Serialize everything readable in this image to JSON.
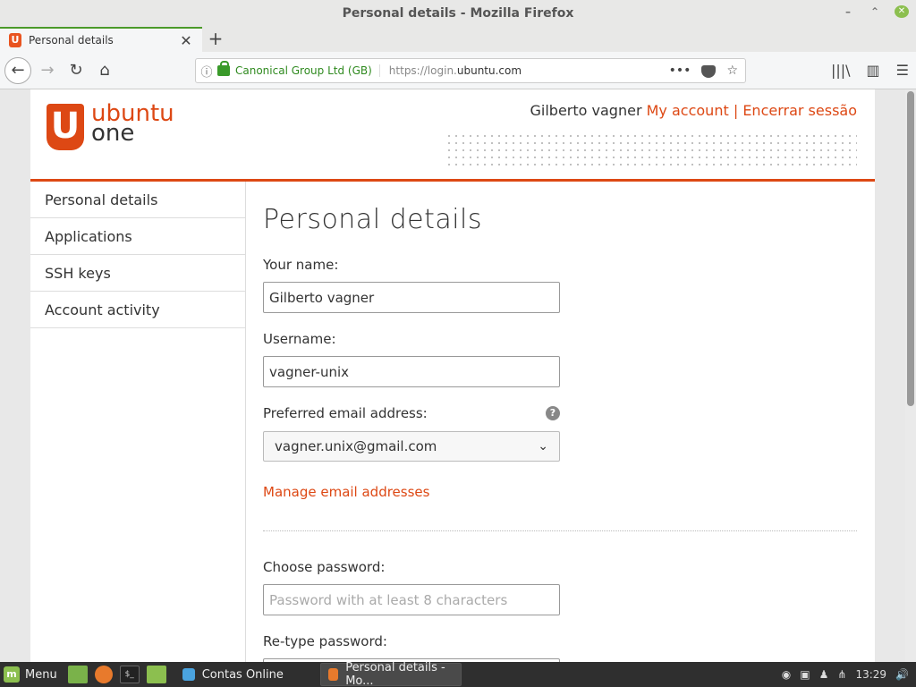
{
  "window": {
    "title": "Personal details - Mozilla Firefox",
    "minimize_glyph": "–",
    "maximize_glyph": "⌃",
    "close_glyph": "✕"
  },
  "tab": {
    "title": "Personal details",
    "favicon_letter": "U",
    "close_glyph": "✕",
    "new_tab_glyph": "+"
  },
  "nav": {
    "back_glyph": "←",
    "forward_glyph": "→",
    "reload_glyph": "↻",
    "home_glyph": "⌂",
    "info_glyph": "ⓘ",
    "organization": "Canonical Group Ltd (GB)",
    "url_prefix": "https://login.",
    "url_domain": "ubuntu.com",
    "more_glyph": "•••",
    "star_glyph": "☆",
    "library_glyph": "|||\\",
    "sidebar_glyph": "▥",
    "menu_glyph": "☰"
  },
  "site": {
    "logo_mark": "U",
    "logo_line1": "ubuntu",
    "logo_line2": "one",
    "user_name": "Gilberto vagner",
    "my_account": "My account",
    "separator": "|",
    "logout": "Encerrar sessão"
  },
  "sidebar": {
    "items": [
      {
        "label": "Personal details"
      },
      {
        "label": "Applications"
      },
      {
        "label": "SSH keys"
      },
      {
        "label": "Account activity"
      }
    ]
  },
  "form": {
    "title": "Personal details",
    "name_label": "Your name:",
    "name_value": "Gilberto vagner",
    "username_label": "Username:",
    "username_value": "vagner-unix",
    "email_label": "Preferred email address:",
    "help_glyph": "?",
    "email_value": "vagner.unix@gmail.com",
    "select_glyph": "⌄",
    "manage_link": "Manage email addresses",
    "password_label": "Choose password:",
    "password_placeholder": "Password with at least 8 characters",
    "retype_label": "Re-type password:"
  },
  "taskbar": {
    "menu_label": "Menu",
    "mint_glyph": "m",
    "term_glyph": "$_",
    "tasks": [
      {
        "label": "Contas Online"
      },
      {
        "label": "Personal details - Mo..."
      }
    ],
    "clock": "13:29",
    "tray_glyphs": [
      "◉",
      "▣",
      "♟",
      "⋔",
      "🔊"
    ]
  }
}
